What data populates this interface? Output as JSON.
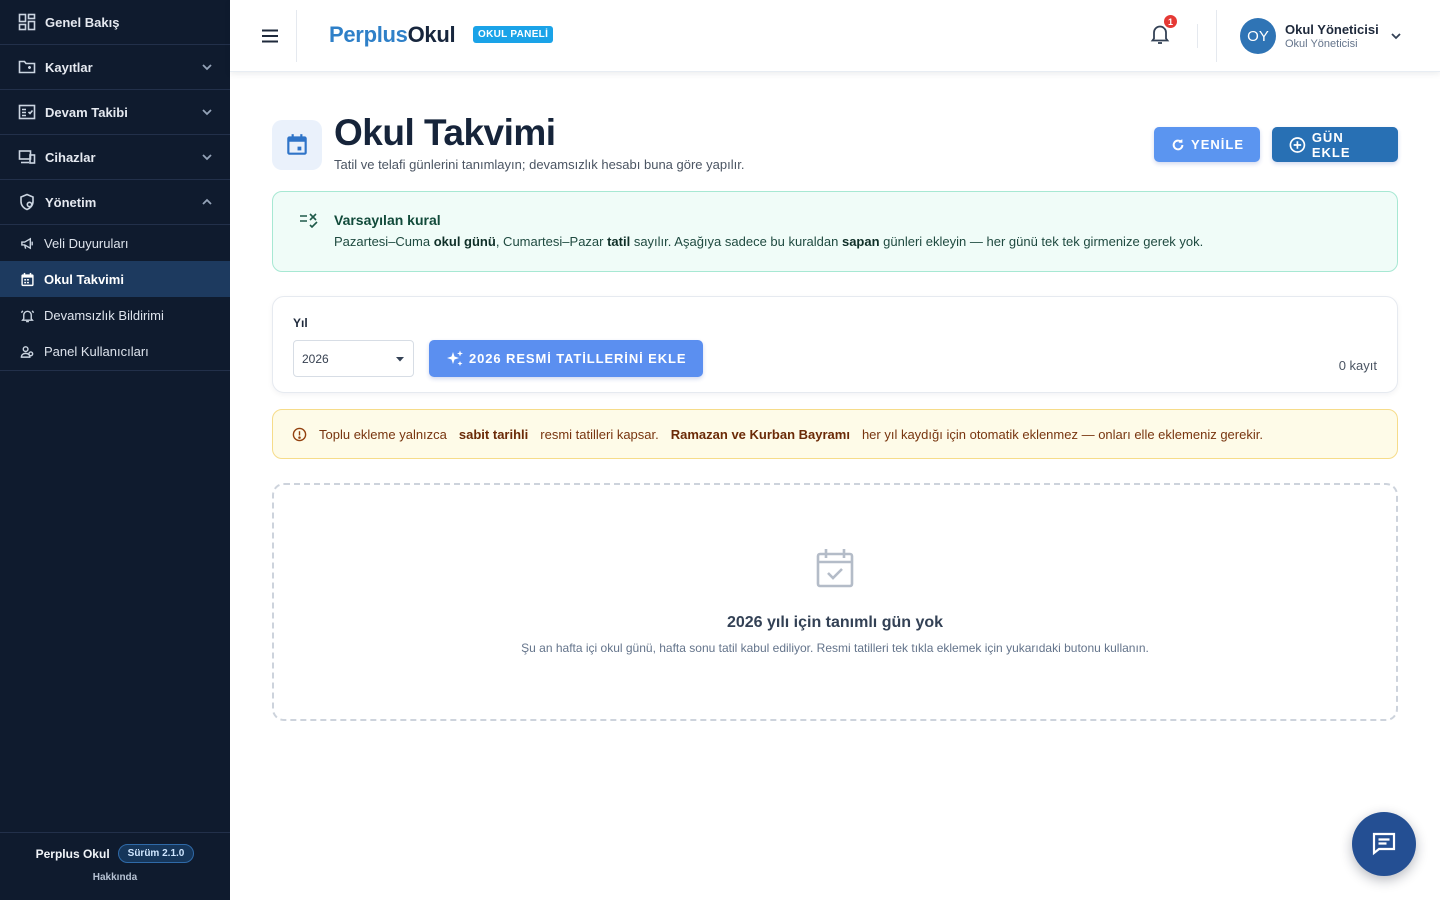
{
  "sidebar": {
    "items": [
      {
        "label": "Genel Bakış"
      },
      {
        "label": "Kayıtlar"
      },
      {
        "label": "Devam Takibi"
      },
      {
        "label": "Cihazlar"
      },
      {
        "label": "Yönetim"
      }
    ],
    "sub_items": [
      {
        "label": "Veli Duyuruları"
      },
      {
        "label": "Okul Takvimi"
      },
      {
        "label": "Devamsızlık Bildirimi"
      },
      {
        "label": "Panel Kullanıcıları"
      }
    ],
    "footer": {
      "brand": "Perplus Okul",
      "version": "Sürüm 2.1.0",
      "about": "Hakkında"
    }
  },
  "header": {
    "logo_part1": "Perplus",
    "logo_part2": "Okul",
    "panel_badge": "OKUL PANELİ",
    "notification_count": "1",
    "user": {
      "initials": "OY",
      "name": "Okul Yöneticisi",
      "role": "Okul Yöneticisi"
    }
  },
  "page": {
    "title": "Okul Takvimi",
    "subtitle": "Tatil ve telafi günlerini tanımlayın; devamsızlık hesabı buna göre yapılır.",
    "refresh_label": "YENİLE",
    "add_day_label": "GÜN EKLE"
  },
  "rule": {
    "title": "Varsayılan kural",
    "t1": "Pazartesi–Cuma ",
    "b1": "okul günü",
    "t2": ", Cumartesi–Pazar ",
    "b2": "tatil",
    "t3": " sayılır. Aşağıya sadece bu kuraldan ",
    "b3": "sapan",
    "t4": " günleri ekleyin — her günü tek tek girmenize gerek yok."
  },
  "year_filter": {
    "label": "Yıl",
    "selected": "2026",
    "holidays_button": "2026 RESMİ TATİLLERİNİ EKLE",
    "record_count": "0 kayıt"
  },
  "warning": {
    "t1": "Toplu ekleme yalnızca",
    "b1": "sabit tarihli",
    "t2": "resmi tatilleri kapsar.",
    "b2": "Ramazan ve Kurban Bayramı",
    "t3": "her yıl kaydığı için otomatik eklenmez — onları elle eklemeniz gerekir."
  },
  "empty_state": {
    "title": "2026 yılı için tanımlı gün yok",
    "subtitle": "Şu an hafta içi okul günü, hafta sonu tatil kabul ediliyor. Resmi tatilleri tek tıkla eklemek için yukarıdaki butonu kullanın."
  },
  "colors": {
    "sidebar_bg": "#0f1b2e",
    "sidebar_active": "#1d3a5f",
    "primary": "#2870b4",
    "primary_light": "#5b95f0",
    "success_bg": "#f0fcf8",
    "warning_bg": "#fefbe8",
    "notification": "#e53935"
  },
  "icons": {
    "genel_bakis": "dashboard-icon",
    "kayitlar": "folder-icon",
    "devam_takibi": "list-check-icon",
    "cihazlar": "devices-icon",
    "yonetim": "admin-shield-icon",
    "veli_duyurulari": "megaphone-icon",
    "okul_takvimi": "calendar-icon",
    "devamsizlik": "alarm-bell-icon",
    "panel_kullanicilari": "users-icon"
  }
}
